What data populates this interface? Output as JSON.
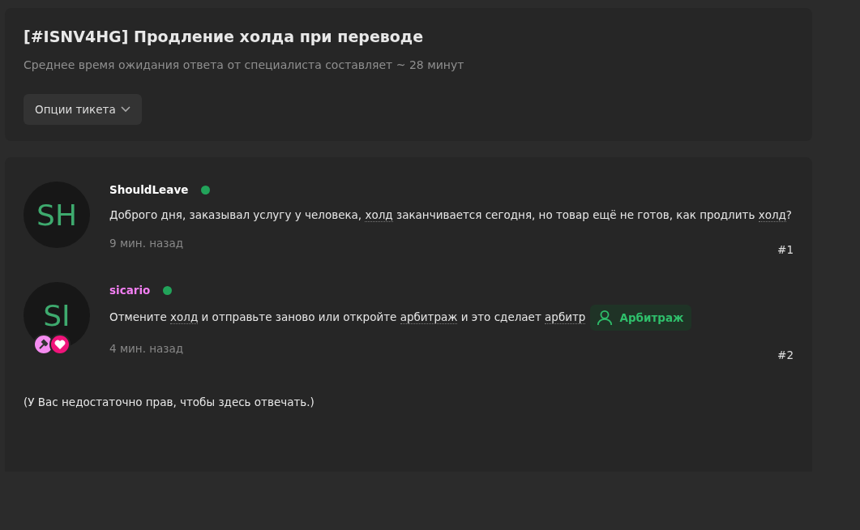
{
  "ticket": {
    "title": "[#ISNV4HG] Продление холда при переводе",
    "subtitle": "Среднее время ожидания ответа от специалиста составляет ~ 28 минут",
    "options_button": "Опции тикета"
  },
  "messages": [
    {
      "initials": "SH",
      "author": "ShouldLeave",
      "color": "#ffffff",
      "online": true,
      "segments": [
        {
          "text": "Доброго дня, заказывал услугу у человека, ",
          "term": false
        },
        {
          "text": "холд",
          "term": true
        },
        {
          "text": " заканчивается сегодня, но товар ещё не готов, как продлить ",
          "term": false
        },
        {
          "text": "холд",
          "term": true
        },
        {
          "text": "?",
          "term": false
        }
      ],
      "time": "9 мин. назад",
      "number": "#1"
    },
    {
      "initials": "SI",
      "author": "sicario",
      "color": "#f27ff2",
      "online": true,
      "segments": [
        {
          "text": "Отмените ",
          "term": false
        },
        {
          "text": "холд",
          "term": true
        },
        {
          "text": " и отправьте заново или откройте ",
          "term": false
        },
        {
          "text": "арбитраж",
          "term": true
        },
        {
          "text": " и это сделает ",
          "term": false
        },
        {
          "text": "арбитр",
          "term": true
        }
      ],
      "time": "4 мин. назад",
      "number": "#2",
      "badges": [
        {
          "kind": "hammer",
          "color": "#f58cf0"
        },
        {
          "kind": "heart",
          "color": "#f0147a"
        }
      ],
      "tag": "Арбитраж"
    }
  ],
  "notice": "(У Вас недостаточно прав, чтобы здесь отвечать.)"
}
